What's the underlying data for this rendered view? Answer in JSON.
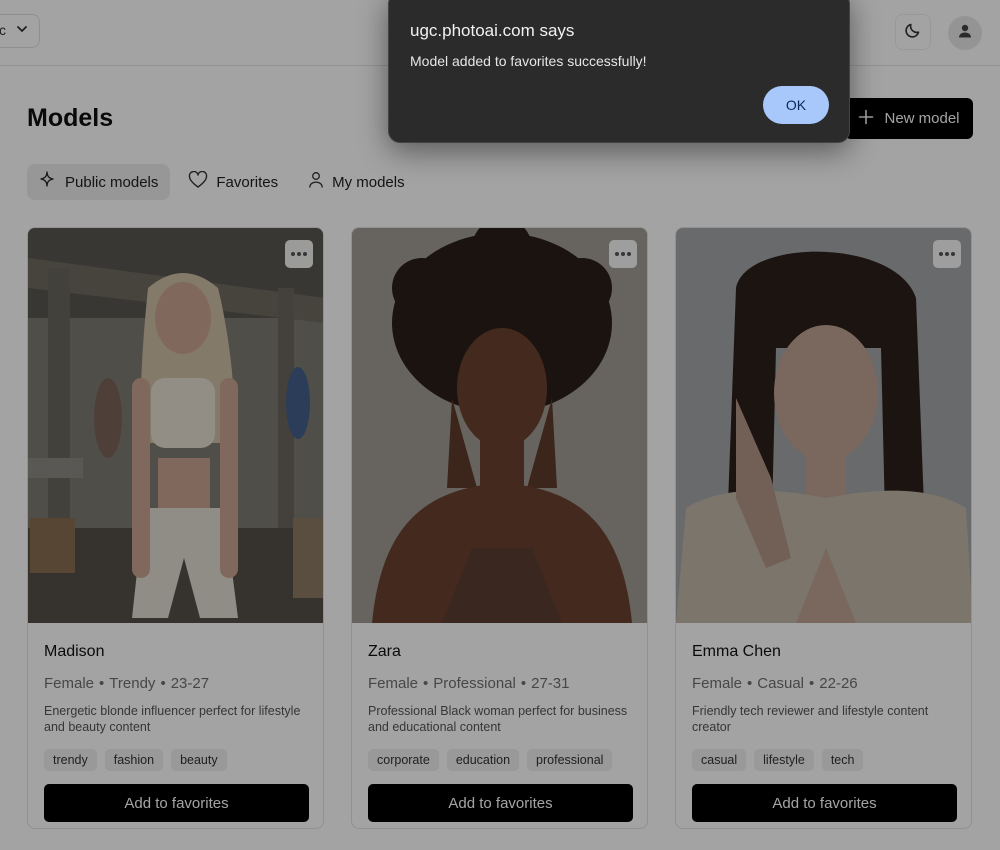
{
  "header": {
    "theme_icon": "moon-icon",
    "profile_icon": "user-icon"
  },
  "page": {
    "title": "Models",
    "new_model_label": "New model"
  },
  "tabs": [
    {
      "label": "Public models",
      "icon": "sparkle-icon",
      "active": true
    },
    {
      "label": "Favorites",
      "icon": "heart-icon",
      "active": false
    },
    {
      "label": "My models",
      "icon": "user-icon",
      "active": false
    }
  ],
  "models": [
    {
      "name": "Madison",
      "gender": "Female",
      "style": "Trendy",
      "age": "23-27",
      "description": "Energetic blonde influencer perfect for lifestyle and beauty content",
      "tags": [
        "trendy",
        "fashion",
        "beauty"
      ],
      "button": "Add to favorites"
    },
    {
      "name": "Zara",
      "gender": "Female",
      "style": "Professional",
      "age": "27-31",
      "description": "Professional Black woman perfect for business and educational content",
      "tags": [
        "corporate",
        "education",
        "professional"
      ],
      "button": "Add to favorites"
    },
    {
      "name": "Emma Chen",
      "gender": "Female",
      "style": "Casual",
      "age": "22-26",
      "description": "Friendly tech reviewer and lifestyle content creator",
      "tags": [
        "casual",
        "lifestyle",
        "tech"
      ],
      "button": "Add to favorites"
    }
  ],
  "dialog": {
    "title": "ugc.photoai.com says",
    "message": "Model added to favorites successfully!",
    "ok_label": "OK"
  }
}
